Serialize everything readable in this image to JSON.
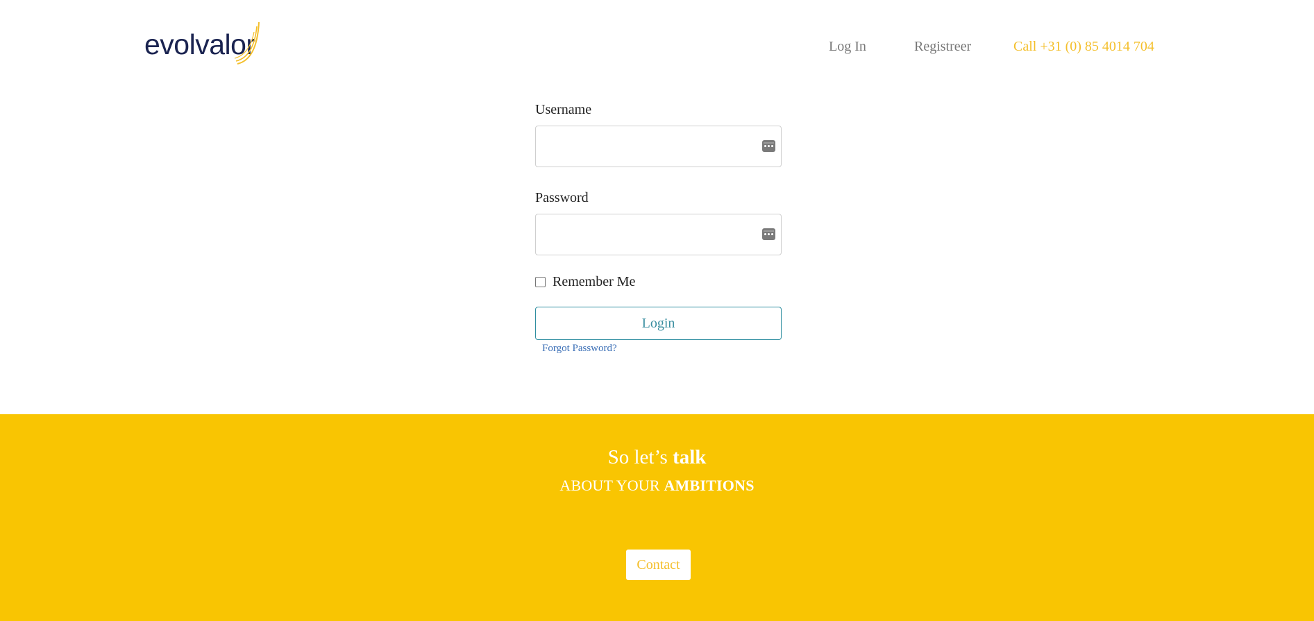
{
  "header": {
    "logo_text": "evolvalor",
    "nav": {
      "login": "Log In",
      "register": "Registreer",
      "call": "Call +31 (0) 85 4014 704"
    }
  },
  "form": {
    "username_label": "Username",
    "username_value": "",
    "password_label": "Password",
    "password_value": "",
    "remember_label": "Remember Me",
    "remember_checked": false,
    "login_button": "Login",
    "forgot_link": "Forgot Password?"
  },
  "cta": {
    "title_normal": "So let’s ",
    "title_bold": "talk",
    "subtitle_normal": "ABOUT YOUR ",
    "subtitle_bold": "AMBITIONS",
    "contact_button": "Contact"
  },
  "colors": {
    "brand_navy": "#1a2350",
    "brand_yellow": "#f9c502",
    "accent_gold": "#f4bf2b",
    "button_teal": "#2e8ea0",
    "link_blue": "#3b6fb6"
  },
  "icons": {
    "logo": "swoosh-logo-icon",
    "field_autofill": "password-manager-key-icon"
  }
}
